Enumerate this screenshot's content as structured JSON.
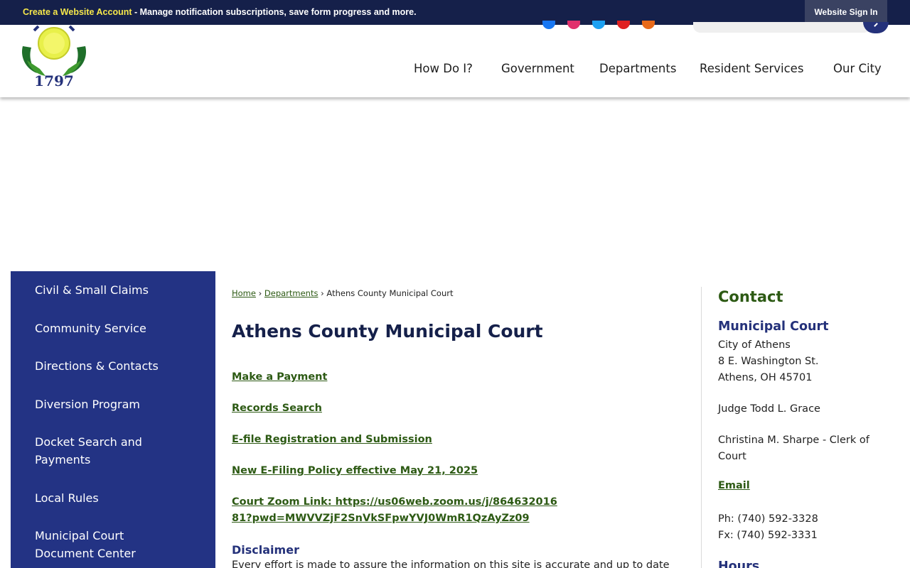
{
  "topbar": {
    "account_label": "Create a Website Account",
    "account_desc": " - Manage notification subscriptions, save form progress and more.",
    "signin_label": "Website Sign In"
  },
  "logo": {
    "year": "1797"
  },
  "nav": {
    "items": [
      "How Do I?",
      "Government",
      "Departments",
      "Resident Services",
      "Our City"
    ]
  },
  "sidebar": {
    "items": [
      "Civil & Small Claims",
      "Community Service",
      "Directions & Contacts",
      "Diversion Program",
      "Docket Search and Payments",
      "Local Rules",
      "Municipal Court Document Center"
    ]
  },
  "breadcrumb": {
    "home": "Home",
    "departments": "Departments",
    "current": "Athens County Municipal Court",
    "sep": "›"
  },
  "main": {
    "title": "Athens County Municipal Court",
    "links": [
      "Make a Payment",
      "Records Search",
      "E-file Registration and Submission ",
      "New E-Filing Policy effective May 21, 2025",
      "Court Zoom Link:  https://us06web.zoom.us/j/86463201681?pwd=MWVVZjF2SnVkSFpwYVJ0WmR1QzAyZz09"
    ],
    "disclaimer_heading": "Disclaimer",
    "disclaimer_text": "Every effort is made to assure the information on this site is accurate and up to date"
  },
  "contact": {
    "heading": "Contact",
    "court_name": "Municipal Court",
    "address": [
      "City of Athens",
      "8 E. Washington St.",
      "Athens, OH 45701"
    ],
    "judge": "Judge Todd L. Grace",
    "clerk": "Christina M. Sharpe - Clerk of Court",
    "email_label": "Email",
    "phone": "Ph: (740) 592-3328",
    "fax": "Fx: (740) 592-3331",
    "hours_heading": "Hours"
  },
  "colors": {
    "topbar_bg": "#15204a",
    "accent_yellow": "#f7e84a",
    "sidebar_bg": "#233384",
    "link_green": "#2d5a14",
    "heading_navy": "#24317a"
  },
  "icons": [
    "facebook-icon",
    "instagram-icon",
    "twitter-icon",
    "youtube-icon",
    "rss-icon",
    "search-icon"
  ]
}
